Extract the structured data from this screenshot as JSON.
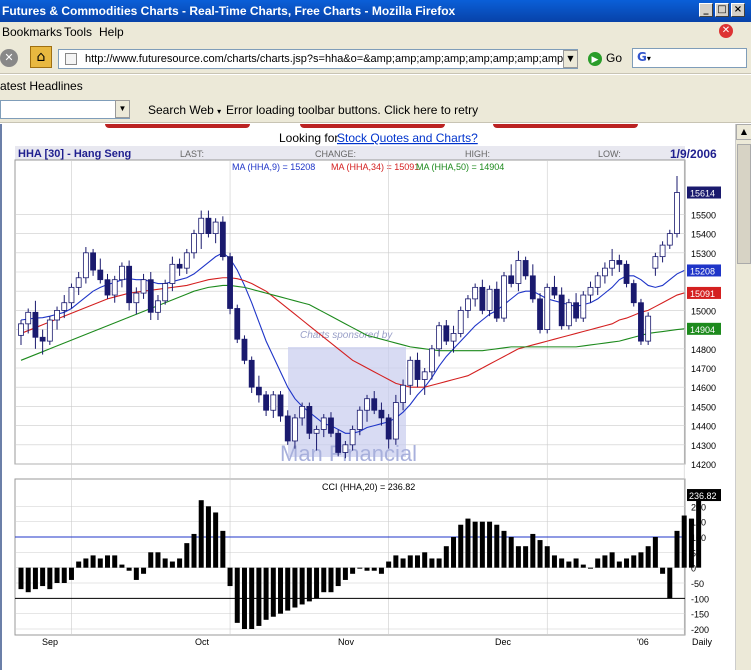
{
  "window": {
    "title": "Futures & Commodities Charts - Real-Time Charts, Free Charts - Mozilla Firefox"
  },
  "menu": {
    "bookmarks": "Bookmarks",
    "tools": "Tools",
    "help": "Help"
  },
  "nav": {
    "url": "http://www.futuresource.com/charts/charts.jsp?s=hha&o=&amp;amp;amp;amp;amp;amp;amp;amp;amp;a=Di",
    "go_label": "Go",
    "search_logo": "G"
  },
  "headlines": {
    "label": "atest Headlines"
  },
  "toolbar": {
    "search_web": "Search Web",
    "error_msg": "Error loading toolbar buttons. Click here to retry"
  },
  "page": {
    "looking_for": "Looking for",
    "stock_link": "Stock Quotes and Charts?"
  },
  "chart_header": {
    "symbol": "HHA [30] - Hang Seng",
    "last": "LAST:",
    "change": "CHANGE:",
    "high": "HIGH:",
    "low": "LOW:",
    "date": "1/9/2006"
  },
  "ma_legend": {
    "ma9": "MA (HHA,9) = 15208",
    "ma34": "MA (HHA,34) = 15091",
    "ma50": "MA (HHA,50) = 14904"
  },
  "cci_title": "CCI (HHA,20) = 236.82",
  "watermark": {
    "sponsored": "Charts sponsored by",
    "brand": "Man Financial"
  },
  "colors": {
    "ma9": "#1f35c8",
    "ma34": "#d42020",
    "ma50": "#1d8a1d",
    "price_tag_bg": "#1a1a6e",
    "grid": "#cccccc",
    "frame_blue": "#1f1f8f"
  },
  "chart_data": [
    {
      "type": "candlestick",
      "title": "HHA [30] - Hang Seng",
      "ylim": [
        14200,
        15700
      ],
      "y_ticks": [
        15500,
        15400,
        15300,
        15200,
        15100,
        15000,
        14900,
        14800,
        14700,
        14600,
        14500,
        14400,
        14300,
        14200
      ],
      "price_labels": {
        "last": "15614",
        "ma9": "15208",
        "ma34": "15091",
        "ma50": "14904"
      },
      "x_labels": [
        "Sep",
        "Oct",
        "Nov",
        "Dec",
        "'06",
        "Daily"
      ],
      "candles": [
        [
          14870,
          14950,
          14820,
          14930
        ],
        [
          14930,
          15010,
          14880,
          14990
        ],
        [
          14990,
          15050,
          14800,
          14860
        ],
        [
          14860,
          14900,
          14770,
          14840
        ],
        [
          14840,
          14970,
          14820,
          14950
        ],
        [
          14950,
          15020,
          14900,
          15000
        ],
        [
          15000,
          15080,
          14960,
          15040
        ],
        [
          15040,
          15140,
          15010,
          15120
        ],
        [
          15120,
          15200,
          15080,
          15170
        ],
        [
          15170,
          15330,
          15140,
          15300
        ],
        [
          15300,
          15320,
          15180,
          15210
        ],
        [
          15210,
          15270,
          15140,
          15160
        ],
        [
          15160,
          15190,
          15060,
          15080
        ],
        [
          15080,
          15180,
          15040,
          15160
        ],
        [
          15160,
          15250,
          15120,
          15230
        ],
        [
          15230,
          15260,
          15000,
          15040
        ],
        [
          15040,
          15120,
          14980,
          15090
        ],
        [
          15090,
          15190,
          15060,
          15160
        ],
        [
          15160,
          15200,
          14950,
          14990
        ],
        [
          14990,
          15080,
          14950,
          15050
        ],
        [
          15050,
          15160,
          15030,
          15140
        ],
        [
          15140,
          15280,
          15100,
          15240
        ],
        [
          15240,
          15270,
          15180,
          15220
        ],
        [
          15220,
          15320,
          15190,
          15300
        ],
        [
          15300,
          15420,
          15270,
          15400
        ],
        [
          15400,
          15520,
          15320,
          15480
        ],
        [
          15480,
          15520,
          15380,
          15400
        ],
        [
          15400,
          15480,
          15350,
          15460
        ],
        [
          15460,
          15490,
          15260,
          15280
        ],
        [
          15280,
          15300,
          14980,
          15010
        ],
        [
          15010,
          15030,
          14830,
          14850
        ],
        [
          14850,
          14870,
          14720,
          14740
        ],
        [
          14740,
          14760,
          14570,
          14600
        ],
        [
          14600,
          14660,
          14520,
          14560
        ],
        [
          14560,
          14580,
          14450,
          14480
        ],
        [
          14480,
          14580,
          14440,
          14560
        ],
        [
          14560,
          14580,
          14420,
          14450
        ],
        [
          14450,
          14480,
          14300,
          14320
        ],
        [
          14320,
          14460,
          14280,
          14440
        ],
        [
          14440,
          14520,
          14400,
          14500
        ],
        [
          14500,
          14520,
          14330,
          14360
        ],
        [
          14360,
          14400,
          14270,
          14380
        ],
        [
          14380,
          14460,
          14340,
          14440
        ],
        [
          14440,
          14470,
          14340,
          14360
        ],
        [
          14360,
          14380,
          14240,
          14260
        ],
        [
          14260,
          14320,
          14230,
          14300
        ],
        [
          14300,
          14400,
          14270,
          14380
        ],
        [
          14380,
          14500,
          14350,
          14480
        ],
        [
          14480,
          14560,
          14420,
          14540
        ],
        [
          14540,
          14580,
          14460,
          14480
        ],
        [
          14480,
          14520,
          14400,
          14440
        ],
        [
          14440,
          14460,
          14280,
          14330
        ],
        [
          14330,
          14560,
          14300,
          14520
        ],
        [
          14520,
          14640,
          14480,
          14610
        ],
        [
          14610,
          14760,
          14560,
          14740
        ],
        [
          14740,
          14780,
          14600,
          14640
        ],
        [
          14640,
          14700,
          14560,
          14680
        ],
        [
          14680,
          14820,
          14640,
          14800
        ],
        [
          14800,
          14940,
          14760,
          14920
        ],
        [
          14920,
          14950,
          14820,
          14840
        ],
        [
          14840,
          14920,
          14780,
          14880
        ],
        [
          14880,
          15020,
          14860,
          15000
        ],
        [
          15000,
          15080,
          14960,
          15060
        ],
        [
          15060,
          15140,
          15020,
          15120
        ],
        [
          15120,
          15160,
          14980,
          15000
        ],
        [
          15000,
          15130,
          14970,
          15110
        ],
        [
          15110,
          15150,
          14940,
          14960
        ],
        [
          14960,
          15200,
          14940,
          15180
        ],
        [
          15180,
          15240,
          15120,
          15140
        ],
        [
          15140,
          15310,
          15100,
          15260
        ],
        [
          15260,
          15280,
          15160,
          15180
        ],
        [
          15180,
          15240,
          15040,
          15060
        ],
        [
          15060,
          15090,
          14880,
          14900
        ],
        [
          14900,
          15140,
          14880,
          15120
        ],
        [
          15120,
          15180,
          15060,
          15080
        ],
        [
          15080,
          15120,
          14900,
          14920
        ],
        [
          14920,
          15060,
          14900,
          15040
        ],
        [
          15040,
          15090,
          14940,
          14960
        ],
        [
          14960,
          15100,
          14940,
          15080
        ],
        [
          15080,
          15150,
          15040,
          15120
        ],
        [
          15120,
          15200,
          15080,
          15180
        ],
        [
          15180,
          15250,
          15140,
          15220
        ],
        [
          15220,
          15320,
          15180,
          15260
        ],
        [
          15260,
          15290,
          15200,
          15240
        ],
        [
          15240,
          15260,
          15120,
          15140
        ],
        [
          15140,
          15160,
          15020,
          15040
        ],
        [
          15040,
          15060,
          14820,
          14840
        ],
        [
          14840,
          14990,
          14820,
          14970
        ],
        [
          15220,
          15300,
          15180,
          15280
        ],
        [
          15280,
          15360,
          15250,
          15340
        ],
        [
          15340,
          15420,
          15320,
          15400
        ],
        [
          15400,
          15700,
          15380,
          15614
        ]
      ],
      "series": [
        {
          "name": "MA (HHA,9)",
          "values": [
            14950,
            14955,
            14960,
            14962,
            14970,
            14980,
            14990,
            15010,
            15040,
            15070,
            15100,
            15120,
            15135,
            15145,
            15160,
            15165,
            15160,
            15160,
            15150,
            15140,
            15140,
            15150,
            15160,
            15170,
            15190,
            15220,
            15250,
            15280,
            15300,
            15270,
            15210,
            15130,
            15040,
            14940,
            14840,
            14760,
            14680,
            14600,
            14540,
            14500,
            14470,
            14440,
            14410,
            14400,
            14380,
            14360,
            14360,
            14370,
            14390,
            14400,
            14410,
            14420,
            14440,
            14470,
            14510,
            14560,
            14600,
            14650,
            14710,
            14760,
            14800,
            14840,
            14880,
            14920,
            14950,
            14980,
            15000,
            15030,
            15060,
            15090,
            15100,
            15100,
            15080,
            15060,
            15050,
            15040,
            15030,
            15020,
            15030,
            15040,
            15060,
            15090,
            15120,
            15160,
            15180,
            15180,
            15160,
            15130,
            15120,
            15130,
            15160,
            15190,
            15208
          ]
        },
        {
          "name": "MA (HHA,34)",
          "values": [
            14880,
            14895,
            14910,
            14925,
            14940,
            14955,
            14970,
            14985,
            15000,
            15015,
            15030,
            15045,
            15060,
            15070,
            15080,
            15090,
            15095,
            15100,
            15105,
            15110,
            15115,
            15120,
            15125,
            15130,
            15140,
            15150,
            15160,
            15165,
            15170,
            15170,
            15165,
            15155,
            15140,
            15120,
            15100,
            15070,
            15040,
            15010,
            14980,
            14950,
            14920,
            14890,
            14860,
            14830,
            14800,
            14770,
            14740,
            14720,
            14700,
            14680,
            14660,
            14640,
            14620,
            14610,
            14600,
            14600,
            14600,
            14610,
            14620,
            14630,
            14640,
            14650,
            14660,
            14680,
            14700,
            14720,
            14740,
            14760,
            14780,
            14800,
            14810,
            14820,
            14830,
            14840,
            14850,
            14860,
            14870,
            14880,
            14890,
            14900,
            14910,
            14920,
            14930,
            14950,
            14960,
            14975,
            14990,
            15000,
            15020,
            15040,
            15060,
            15080,
            15091
          ]
        },
        {
          "name": "MA (HHA,50)",
          "values": [
            14740,
            14755,
            14770,
            14785,
            14800,
            14815,
            14830,
            14845,
            14860,
            14875,
            14890,
            14905,
            14920,
            14935,
            14950,
            14965,
            14980,
            14995,
            15010,
            15025,
            15040,
            15055,
            15070,
            15085,
            15100,
            15110,
            15120,
            15125,
            15130,
            15130,
            15125,
            15120,
            15110,
            15100,
            15090,
            15080,
            15070,
            15060,
            15050,
            15040,
            15030,
            15010,
            14990,
            14970,
            14950,
            14930,
            14910,
            14890,
            14870,
            14860,
            14850,
            14840,
            14830,
            14820,
            14810,
            14805,
            14800,
            14795,
            14790,
            14790,
            14790,
            14790,
            14790,
            14790,
            14790,
            14795,
            14800,
            14805,
            14810,
            14810,
            14810,
            14810,
            14810,
            14810,
            14810,
            14810,
            14810,
            14810,
            14815,
            14820,
            14825,
            14830,
            14835,
            14840,
            14850,
            14860,
            14870,
            14880,
            14885,
            14890,
            14895,
            14900,
            14904
          ]
        }
      ]
    },
    {
      "type": "bar",
      "title": "CCI (HHA,20) = 236.82",
      "ylim": [
        -200,
        250
      ],
      "y_ticks": [
        200,
        150,
        100,
        50,
        0,
        -50,
        -100,
        -150,
        -200
      ],
      "reference_lines": [
        100,
        -100
      ],
      "last_label": "236.82",
      "values": [
        -70,
        -80,
        -70,
        -60,
        -70,
        -50,
        -50,
        -40,
        20,
        30,
        40,
        30,
        40,
        40,
        10,
        -10,
        -40,
        -20,
        50,
        50,
        30,
        20,
        30,
        80,
        110,
        220,
        200,
        180,
        120,
        -60,
        -180,
        -200,
        -200,
        -190,
        -170,
        -160,
        -150,
        -140,
        -130,
        -120,
        -110,
        -100,
        -80,
        -80,
        -60,
        -40,
        -20,
        0,
        -10,
        -10,
        -20,
        20,
        40,
        30,
        40,
        40,
        50,
        30,
        30,
        70,
        100,
        140,
        160,
        150,
        150,
        150,
        140,
        120,
        100,
        70,
        70,
        110,
        90,
        70,
        40,
        30,
        20,
        30,
        10,
        0,
        30,
        40,
        50,
        20,
        30,
        40,
        50,
        70,
        100,
        -20,
        -100,
        120,
        170,
        160,
        236.82
      ]
    }
  ]
}
